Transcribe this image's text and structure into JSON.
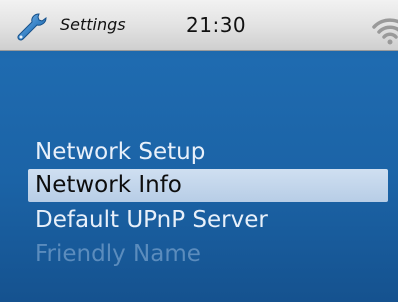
{
  "statusbar": {
    "title": "Settings",
    "time": "21:30",
    "icons": {
      "app": "wrench-icon",
      "signal": "wifi-icon"
    }
  },
  "menu": {
    "items": [
      {
        "label": "Network Setup",
        "state": "normal"
      },
      {
        "label": "Network Info",
        "state": "selected"
      },
      {
        "label": "Default UPnP Server",
        "state": "normal"
      },
      {
        "label": "Friendly Name",
        "state": "disabled"
      }
    ]
  },
  "colors": {
    "background": "#1b63a6",
    "highlight": "#c4d7ec",
    "text": "#e8f0fa",
    "disabled_text": "#5b8cbd",
    "statusbar": "#e3e3e3"
  }
}
